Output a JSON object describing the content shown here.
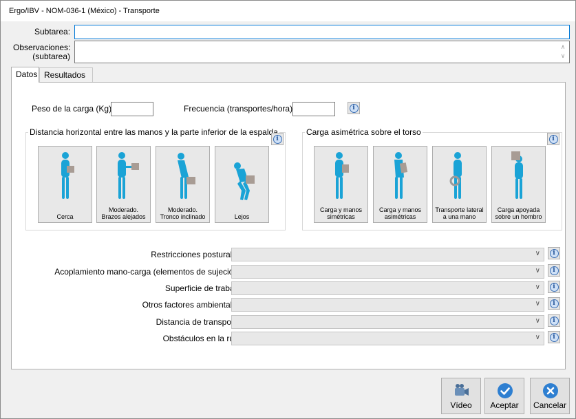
{
  "window": {
    "title": "Ergo/IBV - NOM-036-1 (México) - Transporte"
  },
  "form": {
    "subtarea_label": "Subtarea:",
    "subtarea_value": "",
    "observaciones_label_1": "Observaciones:",
    "observaciones_label_2": "(subtarea)",
    "observaciones_value": ""
  },
  "tabs": [
    {
      "label": "Datos",
      "active": true
    },
    {
      "label": "Resultados",
      "active": false
    }
  ],
  "datos": {
    "peso_label": "Peso de la carga (Kg):",
    "peso_value": "",
    "frecuencia_label": "Frecuencia (transportes/hora):",
    "frecuencia_value": "",
    "distancia_group_title": "Distancia horizontal entre las manos y la parte inferior de la espalda",
    "distancia_options": [
      {
        "line1": "",
        "line2": "Cerca"
      },
      {
        "line1": "Moderado.",
        "line2": "Brazos alejados"
      },
      {
        "line1": "Moderado.",
        "line2": "Tronco inclinado"
      },
      {
        "line1": "",
        "line2": "Lejos"
      }
    ],
    "carga_group_title": "Carga asimétrica sobre el torso",
    "carga_options": [
      {
        "line1": "Carga y manos",
        "line2": "simétricas"
      },
      {
        "line1": "Carga y manos",
        "line2": "asimétricas"
      },
      {
        "line1": "Transporte lateral",
        "line2": "a una mano"
      },
      {
        "line1": "Carga apoyada",
        "line2": "sobre un hombro"
      }
    ],
    "selects": [
      {
        "label": "Restricciones posturales",
        "value": ""
      },
      {
        "label": "Acoplamiento mano-carga (elementos de sujeción)",
        "value": ""
      },
      {
        "label": "Superficie de trabajo",
        "value": ""
      },
      {
        "label": "Otros factores ambientales",
        "value": ""
      },
      {
        "label": "Distancia de transporte",
        "value": ""
      },
      {
        "label": "Obstáculos en la ruta",
        "value": ""
      }
    ]
  },
  "buttons": {
    "video": "Vídeo",
    "aceptar": "Aceptar",
    "cancelar": "Cancelar"
  },
  "colors": {
    "figure": "#1aa3d6",
    "accent": "#0078d7",
    "button_blue": "#2e7fd1"
  }
}
